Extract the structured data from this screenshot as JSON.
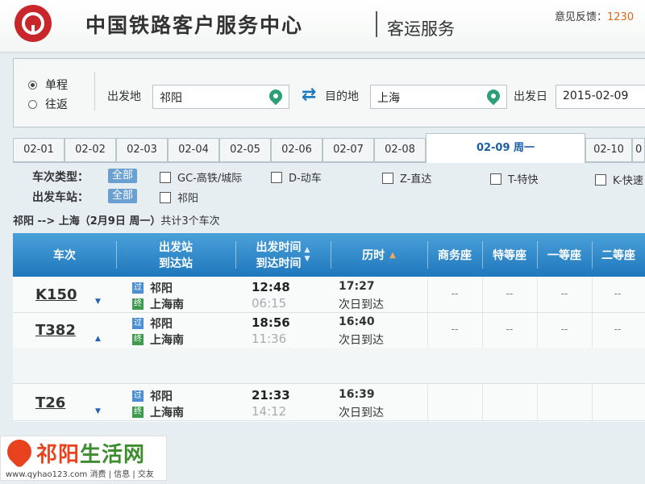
{
  "header": {
    "site_title": "中国铁路客户服务中心",
    "subtitle": "客运服务",
    "feedback_label": "意见反馈：",
    "feedback_phone": "1230"
  },
  "search": {
    "trip_types": [
      "单程",
      "往返"
    ],
    "selected_trip_type": "单程",
    "from_label": "出发地",
    "from_value": "祁阳",
    "to_label": "目的地",
    "to_value": "上海",
    "date_label": "出发日",
    "date_value": "2015-02-09"
  },
  "date_tabs": [
    "02-01",
    "02-02",
    "02-03",
    "02-04",
    "02-05",
    "02-06",
    "02-07",
    "02-08",
    "02-09 周一",
    "02-10",
    "0"
  ],
  "active_date_tab": "02-09 周一",
  "filters": {
    "type_label": "车次类型：",
    "station_label": "出发车站：",
    "all_label": "全部",
    "train_types": [
      "GC-高铁/城际",
      "D-动车",
      "Z-直达",
      "T-特快",
      "K-快速"
    ],
    "stations": [
      "祁阳"
    ]
  },
  "summary": {
    "route": "祁阳 --> 上海（2月9日  周一）",
    "count_text": "共计3个车次"
  },
  "table": {
    "headers": {
      "train": "车次",
      "station_depart": "出发站",
      "station_arrive": "到达站",
      "time_depart": "出发时间",
      "time_arrive": "到达时间",
      "duration": "历时",
      "business": "商务座",
      "premium": "特等座",
      "first": "一等座",
      "second": "二等座"
    },
    "tags": {
      "pass": "过",
      "end": "终"
    },
    "rows": [
      {
        "train": "K150",
        "from": "祁阳",
        "to": "上海南",
        "depart": "12:48",
        "arrive": "06:15",
        "duration": "17:27",
        "arrive_note": "次日到达",
        "seats": [
          "--",
          "--",
          "--",
          "--"
        ]
      },
      {
        "train": "T382",
        "from": "祁阳",
        "to": "上海南",
        "depart": "18:56",
        "arrive": "11:36",
        "duration": "16:40",
        "arrive_note": "次日到达",
        "seats": [
          "--",
          "--",
          "--",
          "--"
        ]
      },
      {
        "train": "T26",
        "from": "祁阳",
        "to": "上海南",
        "depart": "21:33",
        "arrive": "14:12",
        "duration": "16:39",
        "arrive_note": "次日到达",
        "seats": [
          "--",
          "--",
          "--",
          "--"
        ]
      }
    ]
  },
  "watermark": {
    "title_part1": "祁阳",
    "title_part2": "生活网",
    "line": "www.qyhao123.com 消费 | 信息 | 交友"
  }
}
